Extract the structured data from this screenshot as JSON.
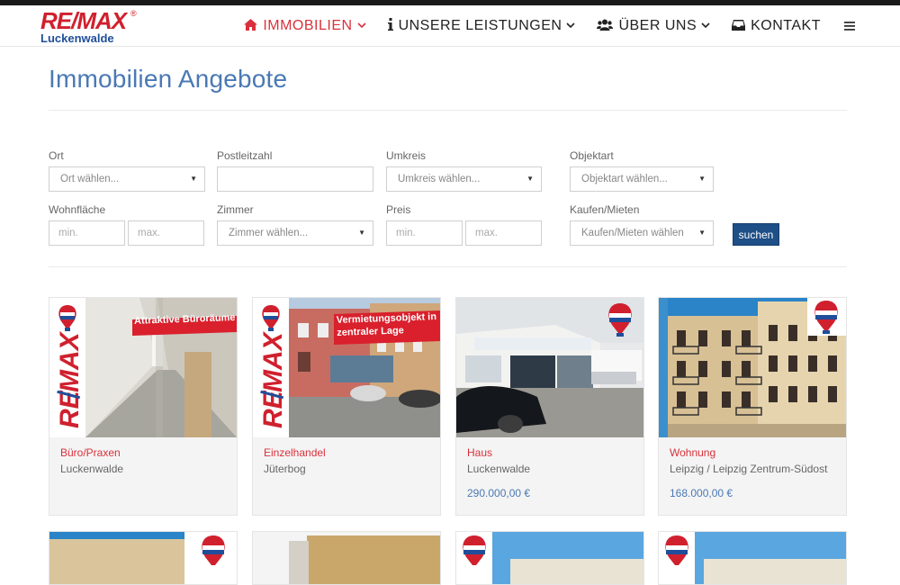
{
  "header": {
    "logo_brand": "RE/MAX",
    "logo_reg": "®",
    "logo_city": "Luckenwalde",
    "nav": [
      {
        "label": "IMMOBILIEN",
        "icon": "home-icon",
        "active": true
      },
      {
        "label": "UNSERE LEISTUNGEN",
        "icon": "info-icon"
      },
      {
        "label": "ÜBER UNS",
        "icon": "users-icon"
      },
      {
        "label": "KONTAKT",
        "icon": "inbox-icon"
      }
    ]
  },
  "page_title": "Immobilien Angebote",
  "search": {
    "ort_label": "Ort",
    "ort_value": "Ort wählen...",
    "plz_label": "Postleitzahl",
    "plz_value": "",
    "umkreis_label": "Umkreis",
    "umkreis_value": "Umkreis wählen...",
    "objektart_label": "Objektart",
    "objektart_value": "Objektart wählen...",
    "wohnflaeche_label": "Wohnfläche",
    "wohnflaeche_min": "min.",
    "wohnflaeche_max": "max.",
    "zimmer_label": "Zimmer",
    "zimmer_value": "Zimmer wählen...",
    "preis_label": "Preis",
    "preis_min": "min.",
    "preis_max": "max.",
    "kaufen_label": "Kaufen/Mieten",
    "kaufen_value": "Kaufen/Mieten wählen",
    "submit_label": "suchen"
  },
  "listings": [
    {
      "type": "Büro/Praxen",
      "location": "Luckenwalde",
      "price": "",
      "banner": "Attraktive Büroräume"
    },
    {
      "type": "Einzelhandel",
      "location": "Jüterbog",
      "price": "",
      "banner": "Vermietungsobjekt in zentraler Lage"
    },
    {
      "type": "Haus",
      "location": "Luckenwalde",
      "price": "290.000,00 €",
      "banner": ""
    },
    {
      "type": "Wohnung",
      "location": "Leipzig / Leipzig Zentrum-Südost",
      "price": "168.000,00 €",
      "banner": ""
    }
  ],
  "colors": {
    "accent_red": "#d9313b",
    "brand_blue": "#1e4f87",
    "title_blue": "#4a79b4"
  }
}
